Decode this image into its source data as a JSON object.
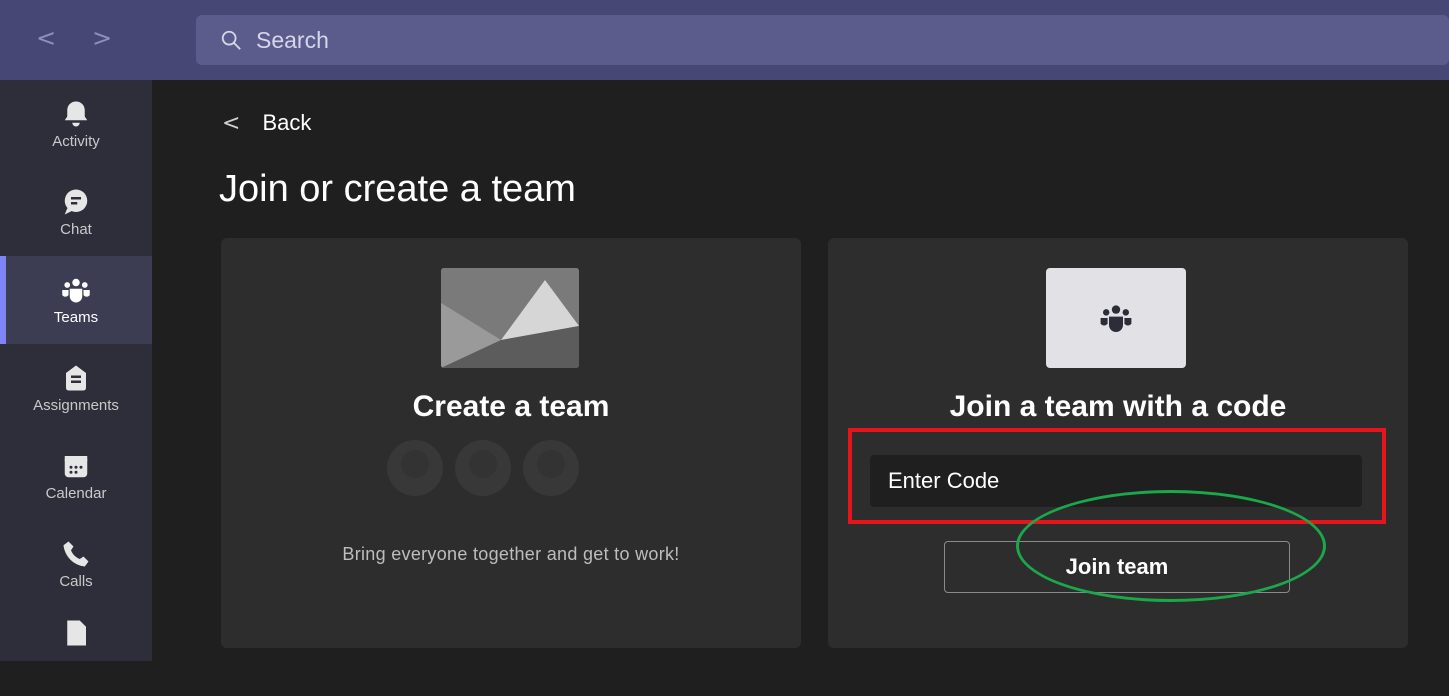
{
  "topbar": {
    "back_arrow": "<",
    "forward_arrow": ">",
    "search_placeholder": "Search"
  },
  "rail": {
    "items": [
      {
        "label": "Activity",
        "icon": "bell-icon"
      },
      {
        "label": "Chat",
        "icon": "chat-icon"
      },
      {
        "label": "Teams",
        "icon": "teams-icon",
        "active": true
      },
      {
        "label": "Assignments",
        "icon": "assignments-icon"
      },
      {
        "label": "Calendar",
        "icon": "calendar-icon"
      },
      {
        "label": "Calls",
        "icon": "phone-icon"
      },
      {
        "label": "",
        "icon": "files-icon"
      }
    ]
  },
  "main": {
    "back_label": "Back",
    "back_chevron": "<",
    "title": "Join or create a team",
    "create_card": {
      "heading": "Create a team",
      "description": "Bring everyone together and get to work!"
    },
    "join_card": {
      "heading": "Join a team with a code",
      "code_placeholder": "Enter Code",
      "join_button": "Join team"
    }
  },
  "colors": {
    "topbar": "#464775",
    "rail": "#2e2e3a",
    "background": "#1f1f1f",
    "card": "#2d2d2d",
    "accent": "#7f85f5",
    "highlight_red": "#e8141b",
    "highlight_green": "#1aa84b"
  }
}
